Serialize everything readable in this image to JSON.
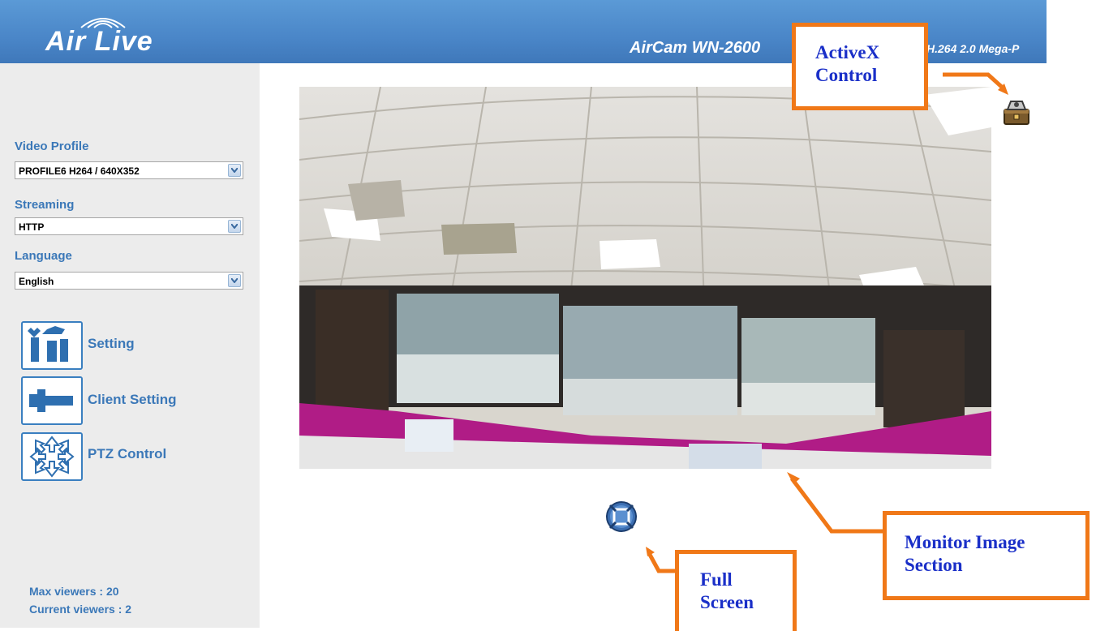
{
  "header": {
    "brand": "Air Live",
    "product_title": "AirCam WN-2600",
    "product_subtitle": "H.264 2.0 Mega-P"
  },
  "sidebar": {
    "video_profile": {
      "label": "Video Profile",
      "value": "PROFILE6 H264 / 640X352"
    },
    "streaming": {
      "label": "Streaming",
      "value": "HTTP"
    },
    "language": {
      "label": "Language",
      "value": "English"
    },
    "menu": [
      {
        "label": "Setting",
        "icon": "tools-icon"
      },
      {
        "label": "Client Setting",
        "icon": "wrench-icon"
      },
      {
        "label": "PTZ Control",
        "icon": "ptz-arrows-icon"
      }
    ],
    "max_viewers": "Max viewers : 20",
    "current_viewers": "Current viewers : 2"
  },
  "callouts": {
    "activex": [
      "ActiveX",
      "Control"
    ],
    "monitor": [
      "Monitor Image",
      "Section"
    ],
    "fullscreen": [
      "Full",
      "Screen"
    ]
  },
  "colors": {
    "header_blue": "#4a86c8",
    "label_blue": "#3b78b8",
    "callout_orange": "#f07818",
    "callout_text": "#1a2fc8"
  }
}
